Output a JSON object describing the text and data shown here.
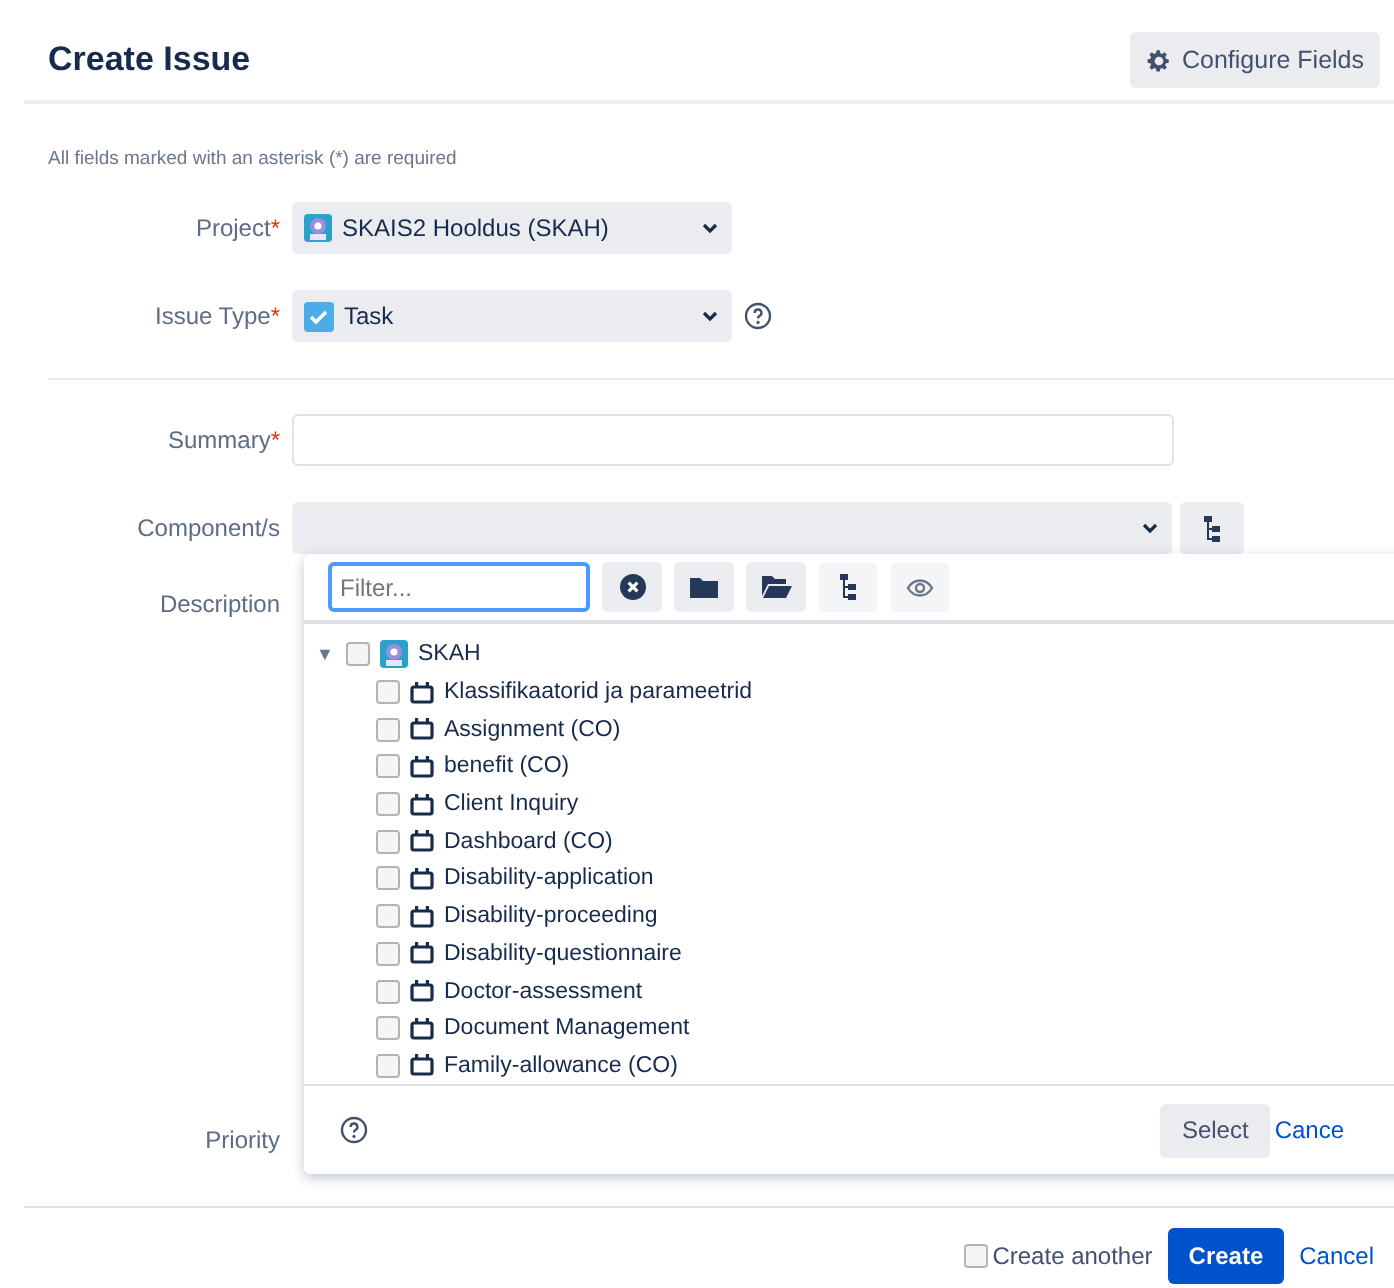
{
  "header": {
    "title": "Create Issue",
    "configure_button": "Configure Fields"
  },
  "required_note": "All fields marked with an asterisk (*) are required",
  "fields": [
    {
      "kind": "project",
      "label": "Project",
      "required_mark": "*",
      "value": "SKAIS2 Hooldus (SKAH)",
      "help": false
    },
    {
      "kind": "issue_type",
      "label": "Issue Type",
      "required_mark": "*",
      "value": "Task",
      "help": true
    },
    {
      "kind": "divider"
    },
    {
      "kind": "text",
      "label": "Summary",
      "required_mark": "*"
    },
    {
      "kind": "component",
      "label": "Component/s"
    },
    {
      "kind": "area",
      "label": "Description"
    },
    {
      "kind": "plain",
      "label": "Priority"
    }
  ],
  "component_picker": {
    "filter_placeholder": "Filter...",
    "tree": [
      {
        "label": "SKAH",
        "toggle": "▼",
        "checked": false,
        "expanded": true,
        "children": [
          {
            "label": "Klassifikaatorid ja parameetrid",
            "checked": false
          },
          {
            "label": "Assignment (CO)",
            "checked": false
          },
          {
            "label": "benefit (CO)",
            "checked": false
          },
          {
            "label": "Client Inquiry",
            "checked": false
          },
          {
            "label": "Dashboard (CO)",
            "checked": false
          },
          {
            "label": "Disability-application",
            "checked": false
          },
          {
            "label": "Disability-proceeding",
            "checked": false
          },
          {
            "label": "Disability-questionnaire",
            "checked": false
          },
          {
            "label": "Doctor-assessment",
            "checked": false
          },
          {
            "label": "Document Management",
            "checked": false
          },
          {
            "label": "Family-allowance (CO)",
            "checked": false
          }
        ]
      }
    ],
    "select_button": "Select",
    "cancel_link": "Cance"
  },
  "footer": {
    "create_another": {
      "label": "Create another",
      "checked": false
    },
    "create_button": "Create",
    "cancel_link": "Cancel"
  }
}
